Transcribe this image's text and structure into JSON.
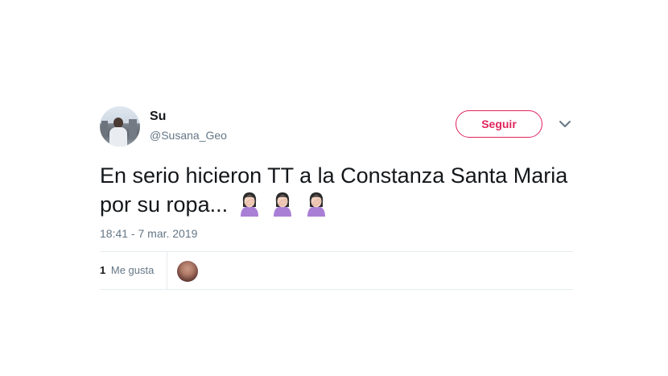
{
  "user": {
    "name": "Su",
    "handle": "@Susana_Geo"
  },
  "follow_button": {
    "label": "Seguir",
    "color": "#e0245e"
  },
  "tweet": {
    "text": "En serio hicieron TT a la Constanza Santa Maria por su ropa...",
    "emoji": [
      "woman-facepalming",
      "woman-facepalming",
      "woman-facepalming"
    ],
    "timestamp": "18:41 - 7 mar. 2019"
  },
  "likes": {
    "count": "1",
    "label": "Me gusta"
  },
  "colors": {
    "text": "#14171a",
    "secondary": "#657786",
    "divider": "#e6ecf0"
  }
}
